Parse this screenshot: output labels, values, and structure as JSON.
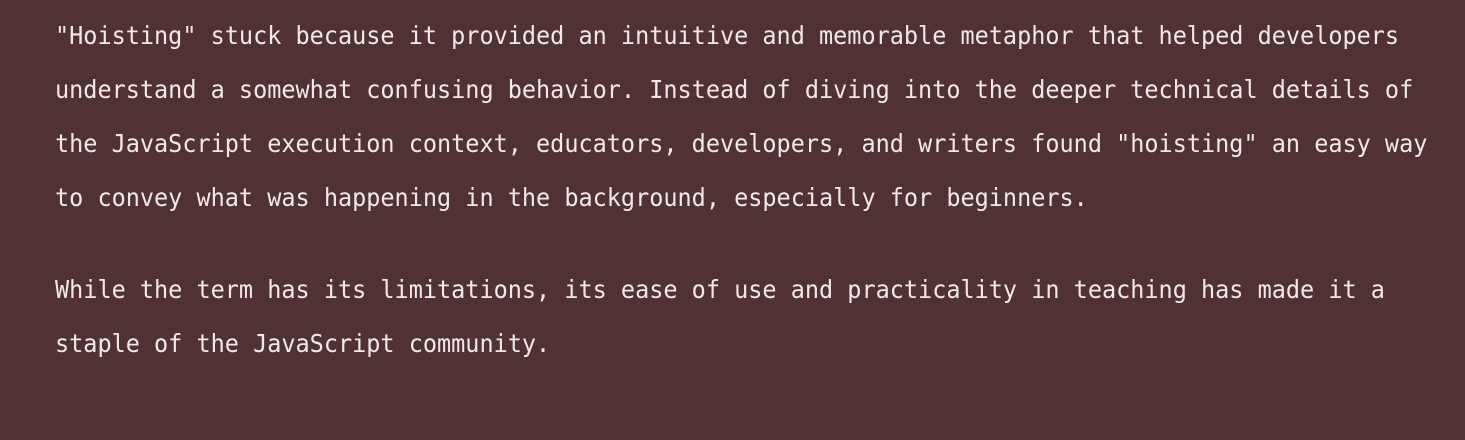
{
  "article": {
    "paragraphs": [
      "\"Hoisting\" stuck because it provided an intuitive and memorable metaphor that helped developers understand a somewhat confusing behavior. Instead of diving into the deeper technical details of the JavaScript execution context, educators, developers, and writers found \"hoisting\" an easy way to convey what was happening in the background, especially for beginners.",
      "While the term has its limitations, its ease of use and practicality in teaching has made it a staple of the JavaScript community."
    ]
  },
  "colors": {
    "background": "#513234",
    "text": "#f1e9e9"
  }
}
